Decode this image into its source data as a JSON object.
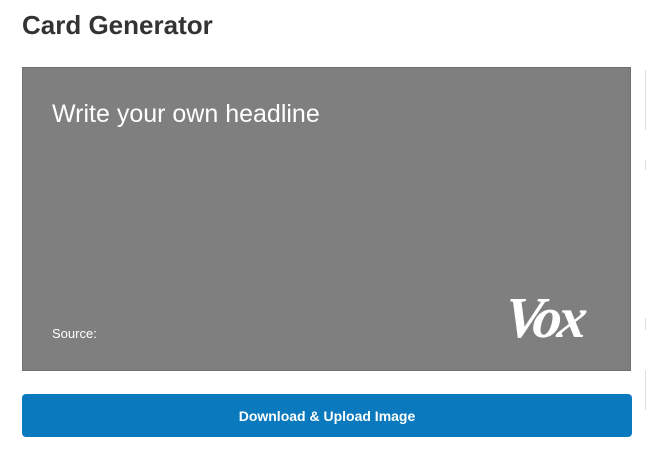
{
  "page": {
    "title": "Card Generator"
  },
  "card": {
    "headline": "Write your own headline",
    "source_label": "Source:",
    "logo_text": "Vox",
    "background_color": "#7f7f7f",
    "text_color": "#ffffff"
  },
  "actions": {
    "download_label": "Download & Upload Image",
    "button_color": "#0a79bd"
  }
}
